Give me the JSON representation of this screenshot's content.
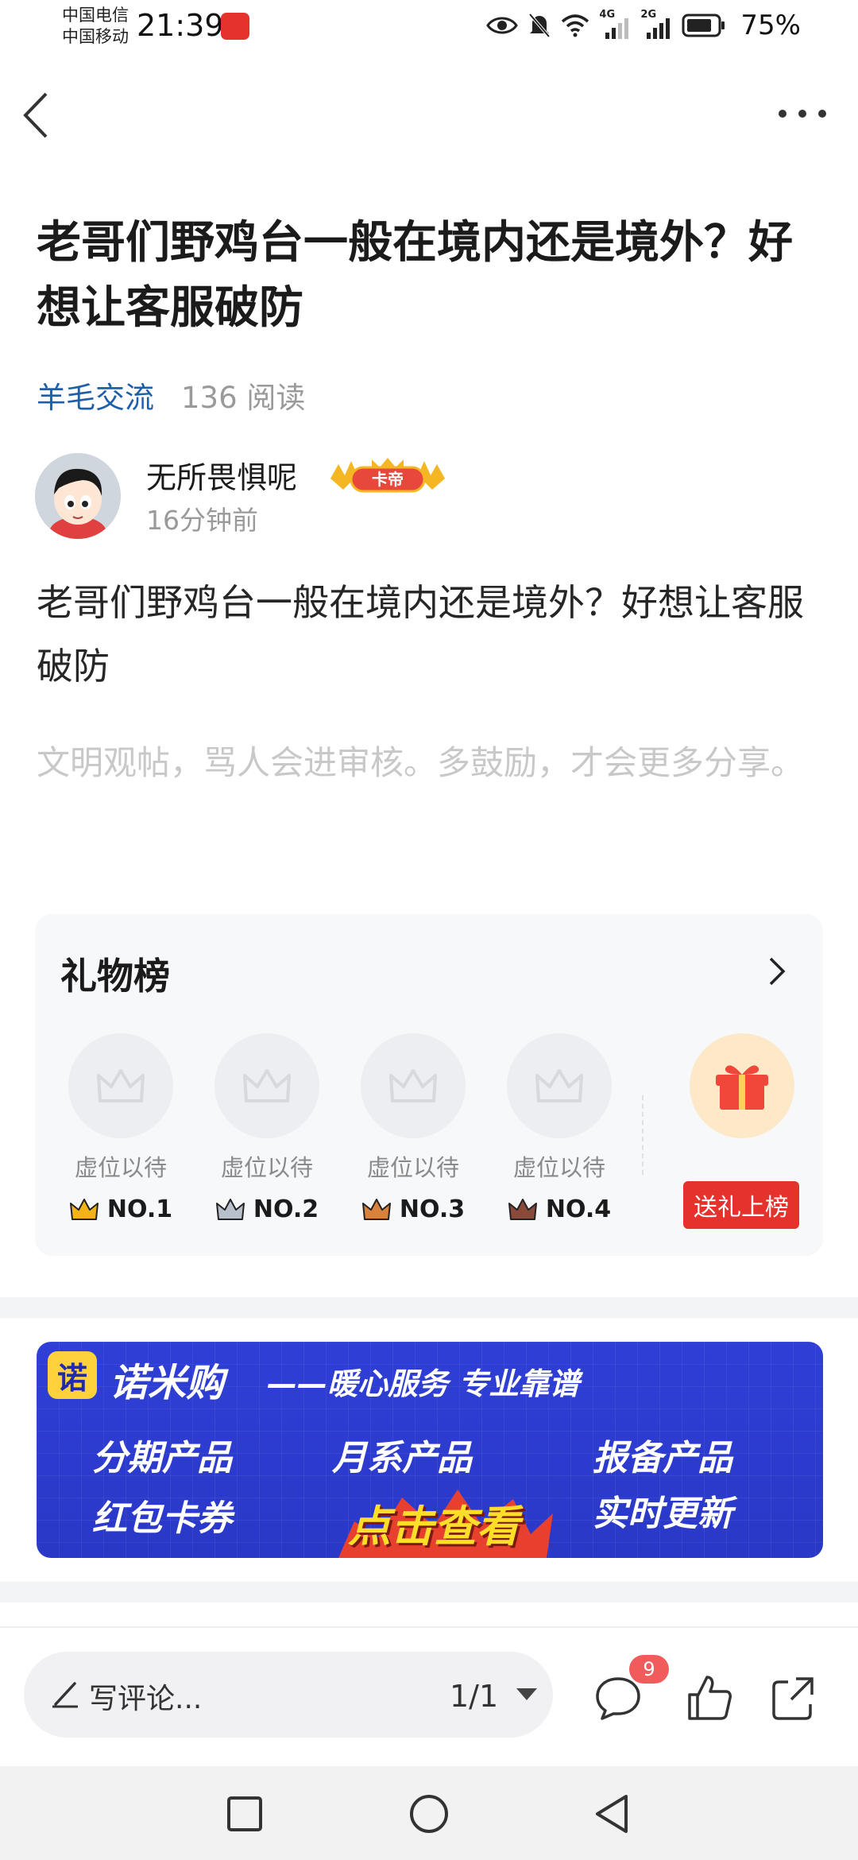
{
  "status_bar": {
    "carrier_1": "中国电信",
    "carrier_2": "中国移动",
    "time": "21:39",
    "net_1": "4G",
    "net_2": "2G",
    "battery": "75%"
  },
  "post": {
    "title": "老哥们野鸡台一般在境内还是境外？好想让客服破防",
    "board": "羊毛交流",
    "reads": "136 阅读",
    "author": "无所畏惧呢",
    "author_badge": "卡帝",
    "time_ago": "16分钟前",
    "body": "老哥们野鸡台一般在境内还是境外？好想让客服破防",
    "hint": "文明观帖，骂人会进审核。多鼓励，才会更多分享。"
  },
  "gift_board": {
    "title": "礼物榜",
    "slots": [
      {
        "placeholder": "虚位以待",
        "rank": "NO.1",
        "crown_color": "#f2b318"
      },
      {
        "placeholder": "虚位以待",
        "rank": "NO.2",
        "crown_color": "#b8c0cc"
      },
      {
        "placeholder": "虚位以待",
        "rank": "NO.3",
        "crown_color": "#d9823b"
      },
      {
        "placeholder": "虚位以待",
        "rank": "NO.4",
        "crown_color": "#8a4a3a"
      }
    ],
    "send_label": "送礼上榜"
  },
  "banner": {
    "logo_char": "诺",
    "brand": "诺米购",
    "slogan": "——暖心服务 专业靠谱",
    "items": [
      "分期产品",
      "月系产品",
      "报备产品",
      "红包卡券",
      "实时更新"
    ],
    "cta": "点击查看"
  },
  "comment_bar": {
    "placeholder": "写评论...",
    "page_indicator": "1/1",
    "comment_count": "9"
  },
  "colors": {
    "accent_blue": "#1e5fa8",
    "gift_red": "#e5322d",
    "banner_blue": "#2f3fd6"
  }
}
